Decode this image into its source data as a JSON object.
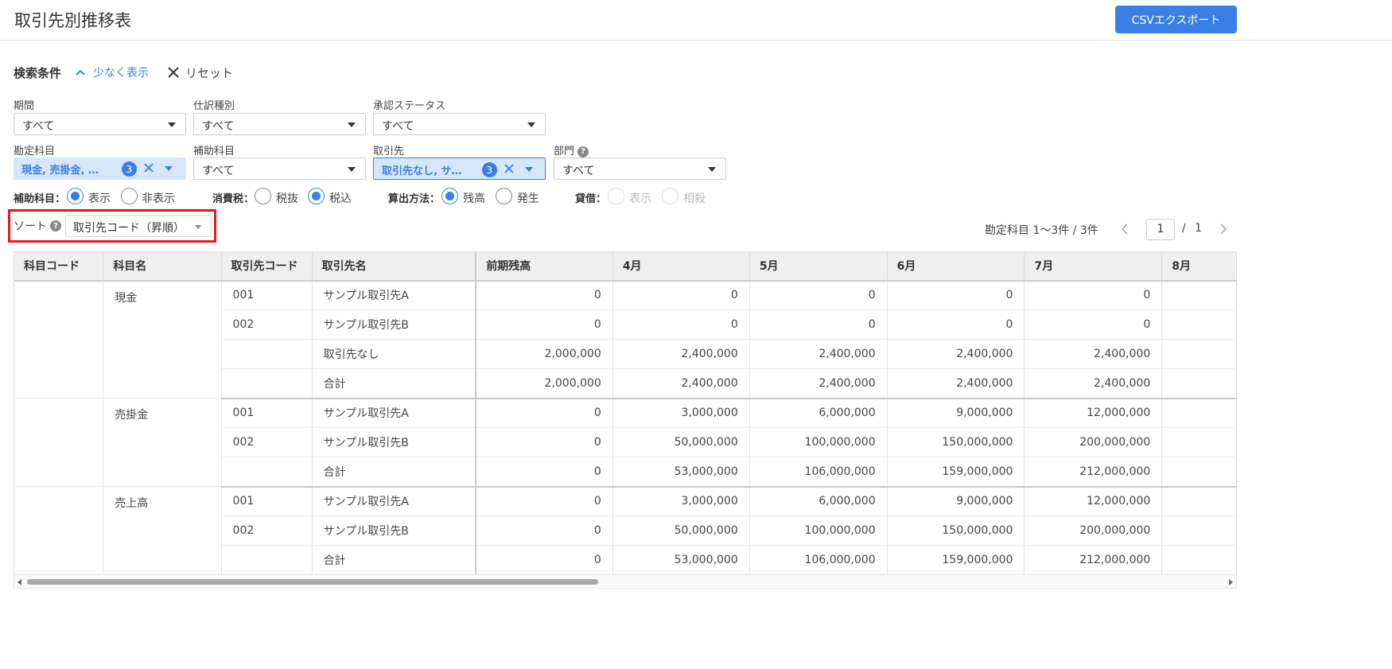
{
  "header": {
    "title": "取引先別推移表",
    "csv_button": "CSVエクスポート"
  },
  "conditions": {
    "title": "検索条件",
    "less_link": "少なく表示",
    "reset_link": "リセット"
  },
  "filters": {
    "period": {
      "label": "期間",
      "value": "すべて"
    },
    "journal_type": {
      "label": "仕訳種別",
      "value": "すべて"
    },
    "approval_status": {
      "label": "承認ステータス",
      "value": "すべて"
    },
    "account": {
      "label": "勘定科目",
      "value": "現金, 売掛金, …",
      "count": "3"
    },
    "sub_account": {
      "label": "補助科目",
      "value": "すべて"
    },
    "partner": {
      "label": "取引先",
      "value": "取引先なし, サ…",
      "count": "3"
    },
    "department": {
      "label": "部門",
      "value": "すべて",
      "help": "?"
    }
  },
  "options": {
    "sub_account": {
      "label": "補助科目：",
      "opt1": "表示",
      "opt2": "非表示",
      "selected": "表示"
    },
    "tax": {
      "label": "消費税：",
      "opt1": "税抜",
      "opt2": "税込",
      "selected": "税込"
    },
    "calc": {
      "label": "算出方法：",
      "opt1": "残高",
      "opt2": "発生",
      "selected": "残高"
    },
    "debit_credit": {
      "label": "貸借：",
      "opt1": "表示",
      "opt2": "相殺"
    }
  },
  "sort": {
    "label": "ソート",
    "help": "?",
    "value": "取引先コード（昇順）"
  },
  "pager": {
    "info": "勘定科目 1〜3件 / 3件",
    "current": "1",
    "slash": "/",
    "total": "1"
  },
  "table": {
    "headers": [
      "科目コード",
      "科目名",
      "取引先コード",
      "取引先名",
      "前期残高",
      "4月",
      "5月",
      "6月",
      "7月",
      "8月"
    ],
    "groups": [
      {
        "account_code": "",
        "account_name": "現金",
        "rows": [
          {
            "code": "001",
            "name": "サンプル取引先A",
            "values": [
              "0",
              "0",
              "0",
              "0",
              "0"
            ]
          },
          {
            "code": "002",
            "name": "サンプル取引先B",
            "values": [
              "0",
              "0",
              "0",
              "0",
              "0"
            ]
          },
          {
            "code": "",
            "name": "取引先なし",
            "values": [
              "2,000,000",
              "2,400,000",
              "2,400,000",
              "2,400,000",
              "2,400,000"
            ]
          },
          {
            "code": "",
            "name": "合計",
            "values": [
              "2,000,000",
              "2,400,000",
              "2,400,000",
              "2,400,000",
              "2,400,000"
            ]
          }
        ]
      },
      {
        "account_code": "",
        "account_name": "売掛金",
        "rows": [
          {
            "code": "001",
            "name": "サンプル取引先A",
            "values": [
              "0",
              "3,000,000",
              "6,000,000",
              "9,000,000",
              "12,000,000"
            ]
          },
          {
            "code": "002",
            "name": "サンプル取引先B",
            "values": [
              "0",
              "50,000,000",
              "100,000,000",
              "150,000,000",
              "200,000,000"
            ]
          },
          {
            "code": "",
            "name": "合計",
            "values": [
              "0",
              "53,000,000",
              "106,000,000",
              "159,000,000",
              "212,000,000"
            ]
          }
        ]
      },
      {
        "account_code": "",
        "account_name": "売上高",
        "rows": [
          {
            "code": "001",
            "name": "サンプル取引先A",
            "values": [
              "0",
              "3,000,000",
              "6,000,000",
              "9,000,000",
              "12,000,000"
            ]
          },
          {
            "code": "002",
            "name": "サンプル取引先B",
            "values": [
              "0",
              "50,000,000",
              "100,000,000",
              "150,000,000",
              "200,000,000"
            ]
          },
          {
            "code": "",
            "name": "合計",
            "values": [
              "0",
              "53,000,000",
              "106,000,000",
              "159,000,000",
              "212,000,000"
            ]
          }
        ]
      }
    ]
  },
  "colors": {
    "accent": "#3a7fe6",
    "chip_bg": "#d7e6f8",
    "highlight_border": "#e5191d",
    "header_bg": "#efefef"
  }
}
